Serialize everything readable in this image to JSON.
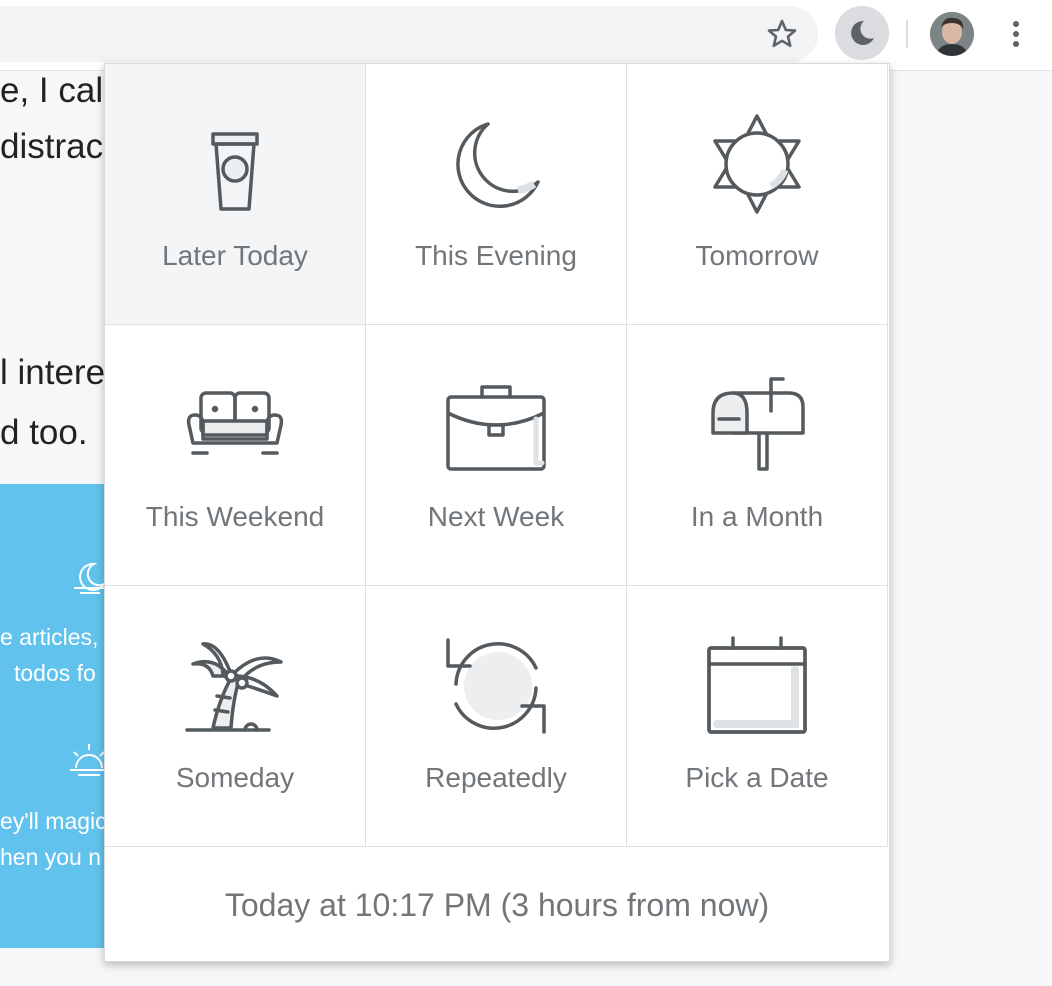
{
  "page": {
    "lines": [
      "e, I calc",
      "distrac",
      "l intere",
      "d too."
    ],
    "blue_lines": [
      "e articles,",
      "todos fo",
      "ey'll magic",
      "hen you n"
    ]
  },
  "popup": {
    "options": [
      {
        "label": "Later Today",
        "icon": "coffee-cup-icon"
      },
      {
        "label": "This Evening",
        "icon": "moon-icon"
      },
      {
        "label": "Tomorrow",
        "icon": "sun-icon"
      },
      {
        "label": "This Weekend",
        "icon": "couch-icon"
      },
      {
        "label": "Next Week",
        "icon": "briefcase-icon"
      },
      {
        "label": "In a Month",
        "icon": "mailbox-icon"
      },
      {
        "label": "Someday",
        "icon": "palm-tree-icon"
      },
      {
        "label": "Repeatedly",
        "icon": "repeat-icon"
      },
      {
        "label": "Pick a Date",
        "icon": "calendar-icon"
      }
    ],
    "footer": "Today at 10:17 PM (3 hours from now)"
  },
  "colors": {
    "icon_stroke": "#545a5e",
    "label": "#71767a",
    "blue_panel": "#61c2ee",
    "highlight": "#f4f5f6"
  }
}
